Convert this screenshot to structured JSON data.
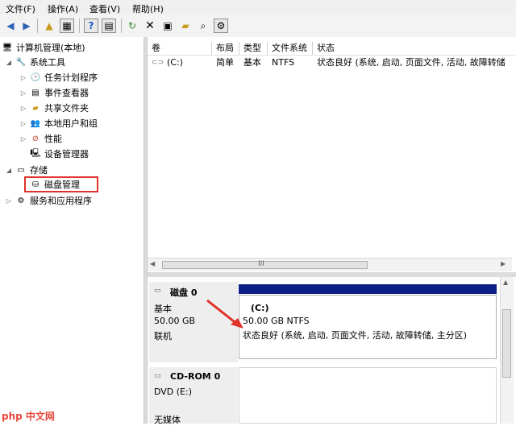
{
  "menu": {
    "file": "文件(F)",
    "action": "操作(A)",
    "view": "查看(V)",
    "help": "帮助(H)"
  },
  "toolbar_icons": [
    "back-icon",
    "forward-icon",
    "up-folder-icon",
    "show-tree-icon",
    "help-icon",
    "console-icon",
    "refresh-icon",
    "delete-icon",
    "properties-icon",
    "open-icon",
    "search-icon",
    "settings-icon"
  ],
  "tree": {
    "root": "计算机管理(本地)",
    "system_tools": "系统工具",
    "task_scheduler": "任务计划程序",
    "event_viewer": "事件查看器",
    "shared_folders": "共享文件夹",
    "local_users": "本地用户和组",
    "performance": "性能",
    "device_manager": "设备管理器",
    "storage": "存储",
    "disk_management": "磁盘管理",
    "services_apps": "服务和应用程序"
  },
  "volume_table": {
    "headers": [
      "卷",
      "布局",
      "类型",
      "文件系统",
      "状态"
    ],
    "rows": [
      [
        "(C:)",
        "简单",
        "基本",
        "NTFS",
        "状态良好 (系统, 启动, 页面文件, 活动, 故障转储"
      ]
    ]
  },
  "scroll_label": "III",
  "disk0": {
    "name": "磁盘 0",
    "type": "基本",
    "size": "50.00 GB",
    "status": "联机"
  },
  "partition": {
    "letter": "(C:)",
    "size": "50.00 GB NTFS",
    "status": "状态良好 (系统, 启动, 页面文件, 活动, 故障转储, 主分区)"
  },
  "cdrom": {
    "name": "CD-ROM 0",
    "drive": "DVD (E:)",
    "media": "无媒体"
  },
  "watermark": "php 中文网",
  "colors": {
    "partition_bar": "#0d1e87",
    "highlight_box": "#e0312a",
    "arrow": "#e0312a"
  }
}
